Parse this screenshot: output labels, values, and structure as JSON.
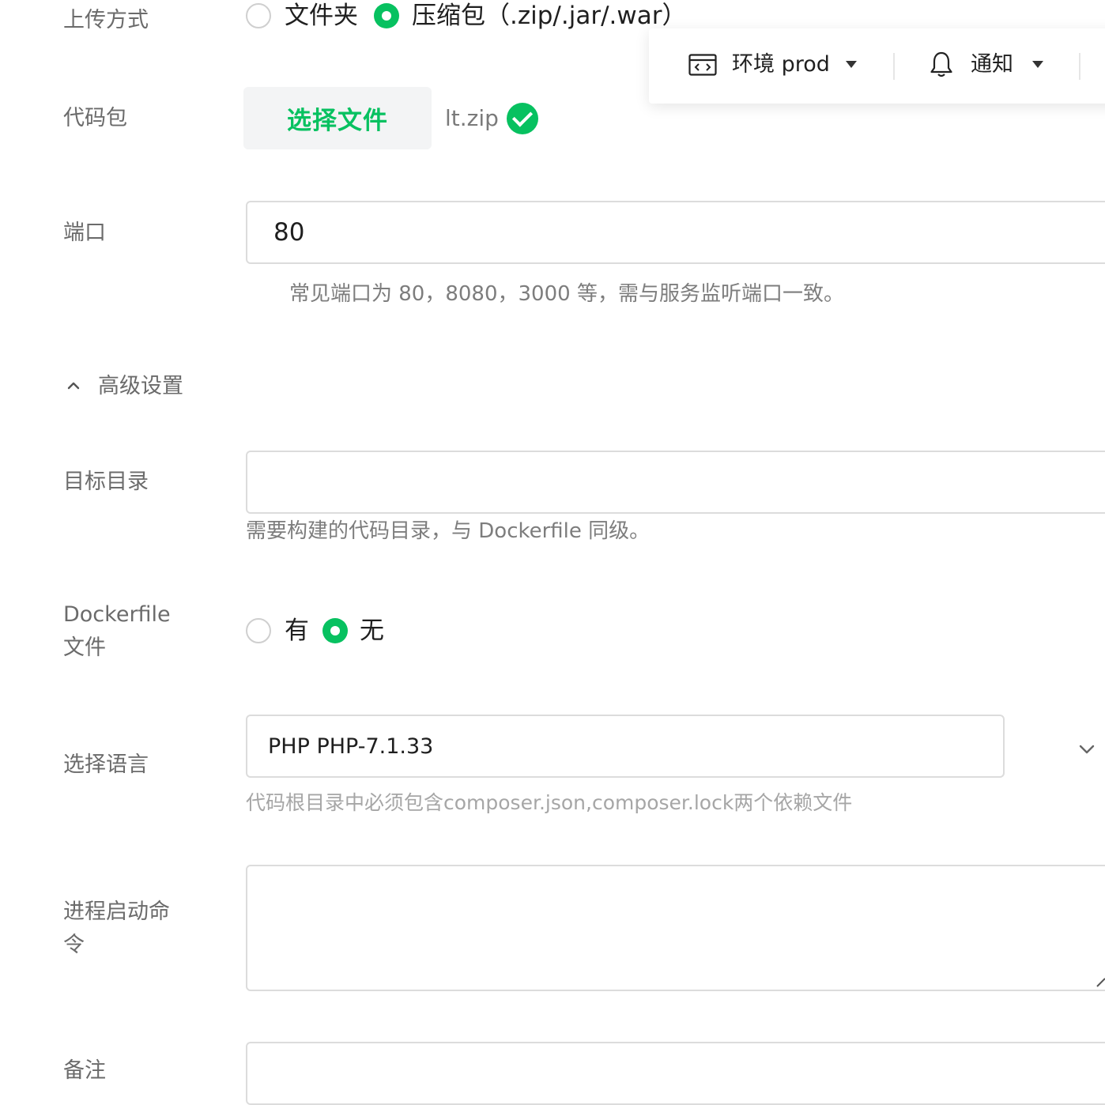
{
  "upload_method": {
    "label": "上传方式",
    "options": [
      {
        "label": "文件夹",
        "selected": false
      },
      {
        "label": "压缩包（.zip/.jar/.war）",
        "selected": true
      }
    ]
  },
  "code_package": {
    "label": "代码包",
    "button_label": "选择文件",
    "file_name": "lt.zip"
  },
  "toolbar": {
    "env_label": "环境 prod",
    "notify_label": "通知"
  },
  "port": {
    "label": "端口",
    "value": "80",
    "hint": "常见端口为 80，8080，3000 等，需与服务监听端口一致。"
  },
  "advanced": {
    "label": "高级设置"
  },
  "target_dir": {
    "label": "目标目录",
    "value": "",
    "hint": "需要构建的代码目录，与 Dockerfile 同级。"
  },
  "dockerfile": {
    "label_line1": "Dockerfile",
    "label_line2": "文件",
    "options": [
      {
        "label": "有",
        "selected": false
      },
      {
        "label": "无",
        "selected": true
      }
    ]
  },
  "language": {
    "label": "选择语言",
    "value": "PHP PHP-7.1.33",
    "hint": "代码根目录中必须包含composer.json,composer.lock两个依赖文件"
  },
  "start_command": {
    "label_line1": "进程启动命",
    "label_line2": "令",
    "value": ""
  },
  "remark": {
    "label": "备注"
  },
  "colors": {
    "accent": "#07c160"
  }
}
